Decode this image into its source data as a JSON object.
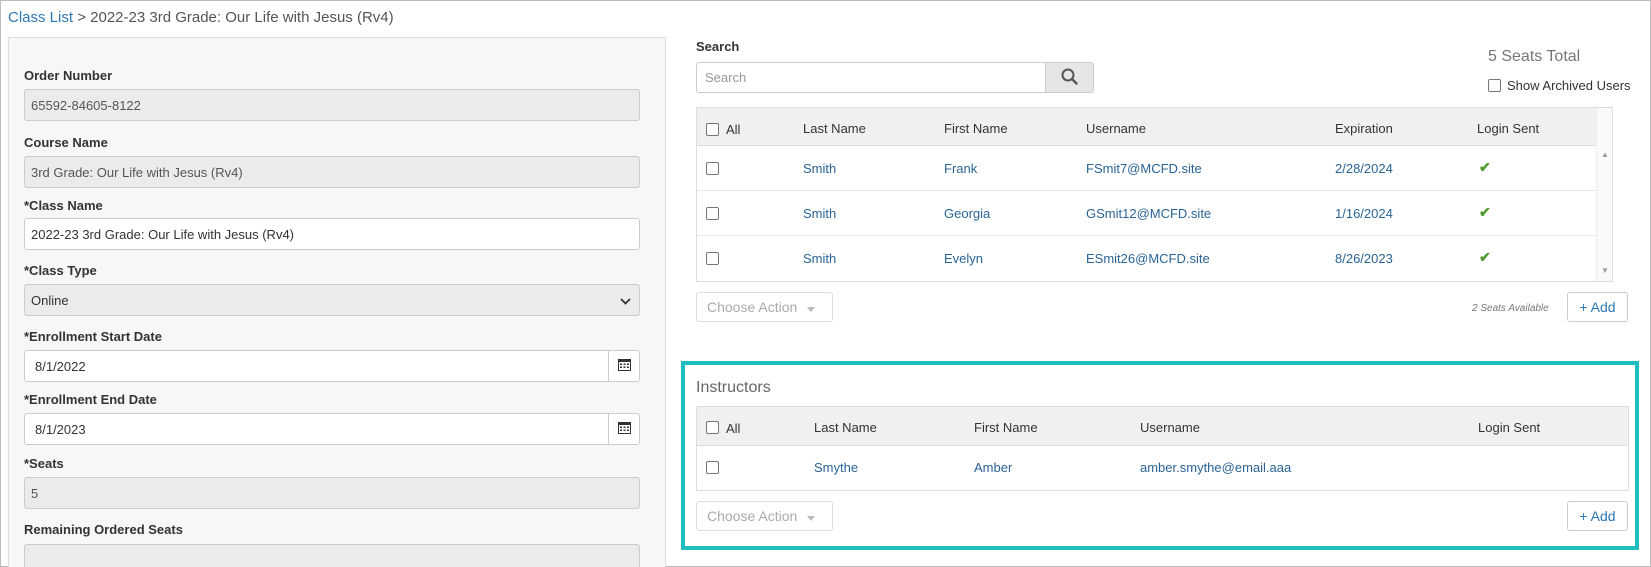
{
  "breadcrumb": {
    "root": "Class List",
    "separator": ">",
    "current": "2022-23 3rd Grade: Our Life with Jesus (Rv4)"
  },
  "form": {
    "order_number_label": "Order Number",
    "order_number": "65592-84605-8122",
    "course_name_label": "Course Name",
    "course_name": "3rd Grade: Our Life with Jesus (Rv4)",
    "class_name_label": "*Class Name",
    "class_name": "2022-23 3rd Grade: Our Life with Jesus (Rv4)",
    "class_type_label": "*Class Type",
    "class_type": "Online",
    "enroll_start_label": "*Enrollment Start Date",
    "enroll_start": "8/1/2022",
    "enroll_end_label": "*Enrollment End Date",
    "enroll_end": "8/1/2023",
    "seats_label": "*Seats",
    "seats": "5",
    "remaining_label": "Remaining Ordered Seats"
  },
  "search": {
    "label": "Search",
    "placeholder": "Search"
  },
  "seats_total": "5 Seats Total",
  "show_archived": "Show Archived Users",
  "students": {
    "headers": {
      "all": "All",
      "last": "Last Name",
      "first": "First Name",
      "user": "Username",
      "exp": "Expiration",
      "login": "Login Sent"
    },
    "rows": [
      {
        "last": "Smith",
        "first": "Frank",
        "user": "FSmit7@MCFD.site",
        "exp": "2/28/2024",
        "login": "✔"
      },
      {
        "last": "Smith",
        "first": "Georgia",
        "user": "GSmit12@MCFD.site",
        "exp": "1/16/2024",
        "login": "✔"
      },
      {
        "last": "Smith",
        "first": "Evelyn",
        "user": "ESmit26@MCFD.site",
        "exp": "8/26/2023",
        "login": "✔"
      }
    ],
    "choose_action": "Choose Action",
    "seats_available": "2 Seats Available",
    "add": "+ Add"
  },
  "instructors": {
    "title": "Instructors",
    "headers": {
      "all": "All",
      "last": "Last Name",
      "first": "First Name",
      "user": "Username",
      "login": "Login Sent"
    },
    "rows": [
      {
        "last": "Smythe",
        "first": "Amber",
        "user": "amber.smythe@email.aaa"
      }
    ],
    "choose_action": "Choose Action",
    "add": "+ Add"
  },
  "colors": {
    "link": "#2e78b4",
    "highlight": "#1fbfbf",
    "check": "#4e9a2e"
  }
}
